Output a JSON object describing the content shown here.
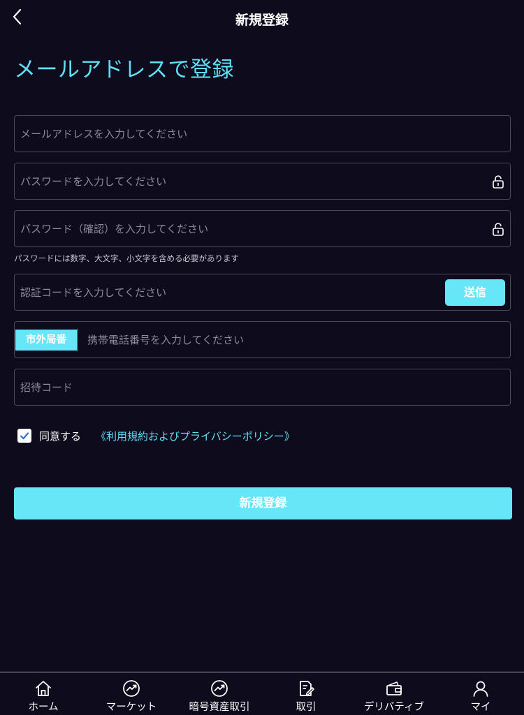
{
  "header": {
    "back_icon": "chevron-left-icon",
    "title": "新規登録"
  },
  "heading": "メールアドレスで登録",
  "form": {
    "email": {
      "placeholder": "メールアドレスを入力してください",
      "value": ""
    },
    "password": {
      "placeholder": "パスワードを入力してください",
      "value": "",
      "icon": "lock-icon"
    },
    "password_confirm": {
      "placeholder": "パスワード（確認）を入力してください",
      "value": "",
      "icon": "lock-icon"
    },
    "password_hint": "パスワードには数字、大文字、小文字を含める必要があります",
    "verification": {
      "placeholder": "認証コードを入力してください",
      "value": "",
      "send_label": "送信"
    },
    "phone": {
      "area_code_label": "市外局番",
      "placeholder": "携帯電話番号を入力してください",
      "value": ""
    },
    "invite": {
      "placeholder": "招待コード",
      "value": ""
    },
    "agree": {
      "checked": true,
      "label": "同意する",
      "terms_link": "《利用規約およびプライバシーポリシー》"
    },
    "submit_label": "新規登録"
  },
  "nav": {
    "items": [
      {
        "label": "ホーム",
        "icon": "home-icon"
      },
      {
        "label": "マーケット",
        "icon": "market-trend-icon"
      },
      {
        "label": "暗号資産取引",
        "icon": "trade-trend-icon"
      },
      {
        "label": "取引",
        "icon": "document-edit-icon"
      },
      {
        "label": "デリバティブ",
        "icon": "wallet-icon"
      },
      {
        "label": "マイ",
        "icon": "user-icon"
      }
    ]
  },
  "colors": {
    "background": "#0d0b1c",
    "accent": "#5ee0f5",
    "button": "#67e6f7",
    "border": "#4b4a5a"
  }
}
